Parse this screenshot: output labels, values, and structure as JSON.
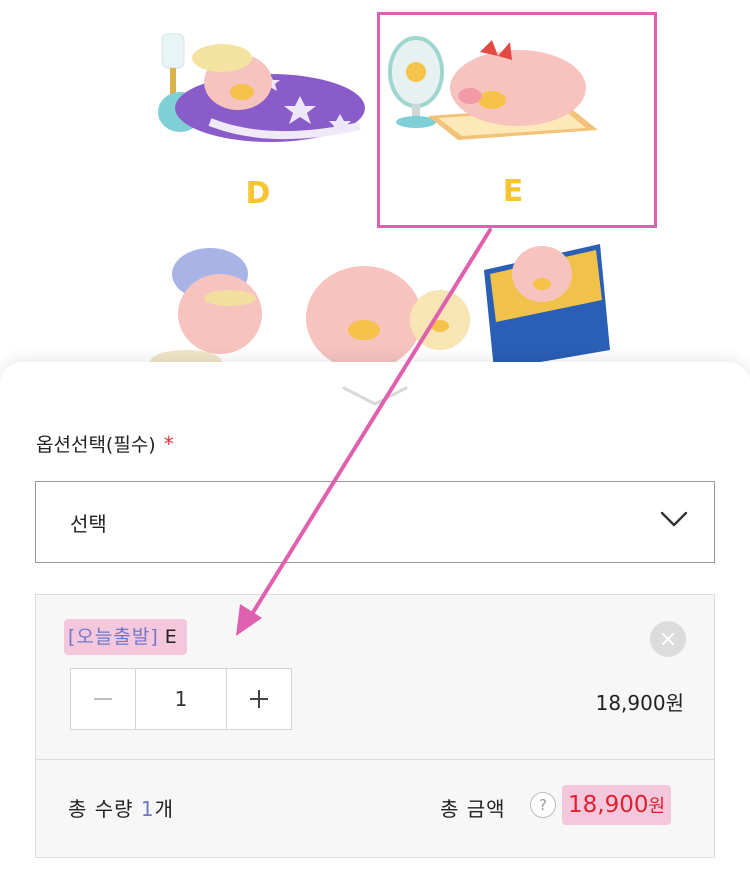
{
  "product": {
    "variants": [
      {
        "letter": "D"
      },
      {
        "letter": "E"
      }
    ]
  },
  "option": {
    "label": "옵션선택(필수)",
    "required_mark": "*",
    "select_value": "선택"
  },
  "item": {
    "tag": "[오늘출발]",
    "variant": "E",
    "quantity": "1",
    "price": "18,900원"
  },
  "totals": {
    "qty_label": "총 수량",
    "qty_value": "1",
    "qty_unit": "개",
    "amount_label": "총 금액",
    "help": "?",
    "amount_value": "18,900",
    "amount_unit": "원"
  },
  "colors": {
    "accent_pink": "#e060b0",
    "price_red": "#e0202f",
    "tag_blue": "#6f78c8",
    "variant_yellow": "#f7c531"
  }
}
